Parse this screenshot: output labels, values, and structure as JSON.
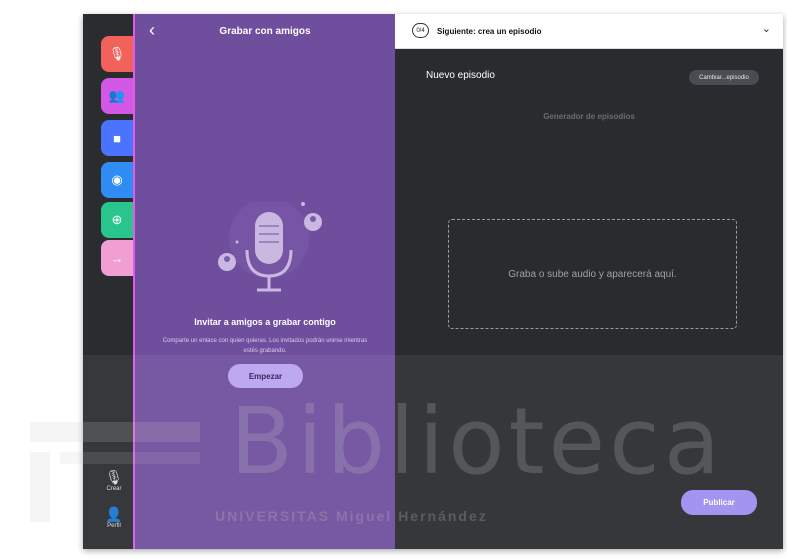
{
  "rail": {
    "tabs": [
      {
        "icon": "mic-icon",
        "color": "#f0625a",
        "glyph": "🎙"
      },
      {
        "icon": "people-icon",
        "color": "#d458e6",
        "glyph": "👥"
      },
      {
        "icon": "folder-icon",
        "color": "#4a73ff",
        "glyph": "■"
      },
      {
        "icon": "spotify-icon",
        "color": "#2e8cf2",
        "glyph": "◉"
      },
      {
        "icon": "add-circle-icon",
        "color": "#2ac58c",
        "glyph": "⊕"
      },
      {
        "icon": "arrow-right-icon",
        "color": "#f19fd2",
        "glyph": "→"
      }
    ],
    "create_label": "Crear",
    "profile_label": "Perfil"
  },
  "left_panel": {
    "title": "Grabar con amigos",
    "invite_title": "Invitar a amigos a grabar contigo",
    "invite_desc": "Comparte un enlace con quien quieras. Los invitados podrán unirse mientras estés grabando.",
    "start_label": "Empezar"
  },
  "right_panel": {
    "step_badge": "0/4",
    "next_text": "Siguiente: crea un episodio",
    "episode_title": "Nuevo episodio",
    "change_label": "Cambiar...episodio",
    "generator_label": "Generador de episodios",
    "drop_text": "Graba o sube audio y aparecerá aquí.",
    "publish_label": "Publicar"
  },
  "watermark": {
    "main": "Biblioteca",
    "sub": "UNIVERSITAS Miguel Hernández"
  }
}
